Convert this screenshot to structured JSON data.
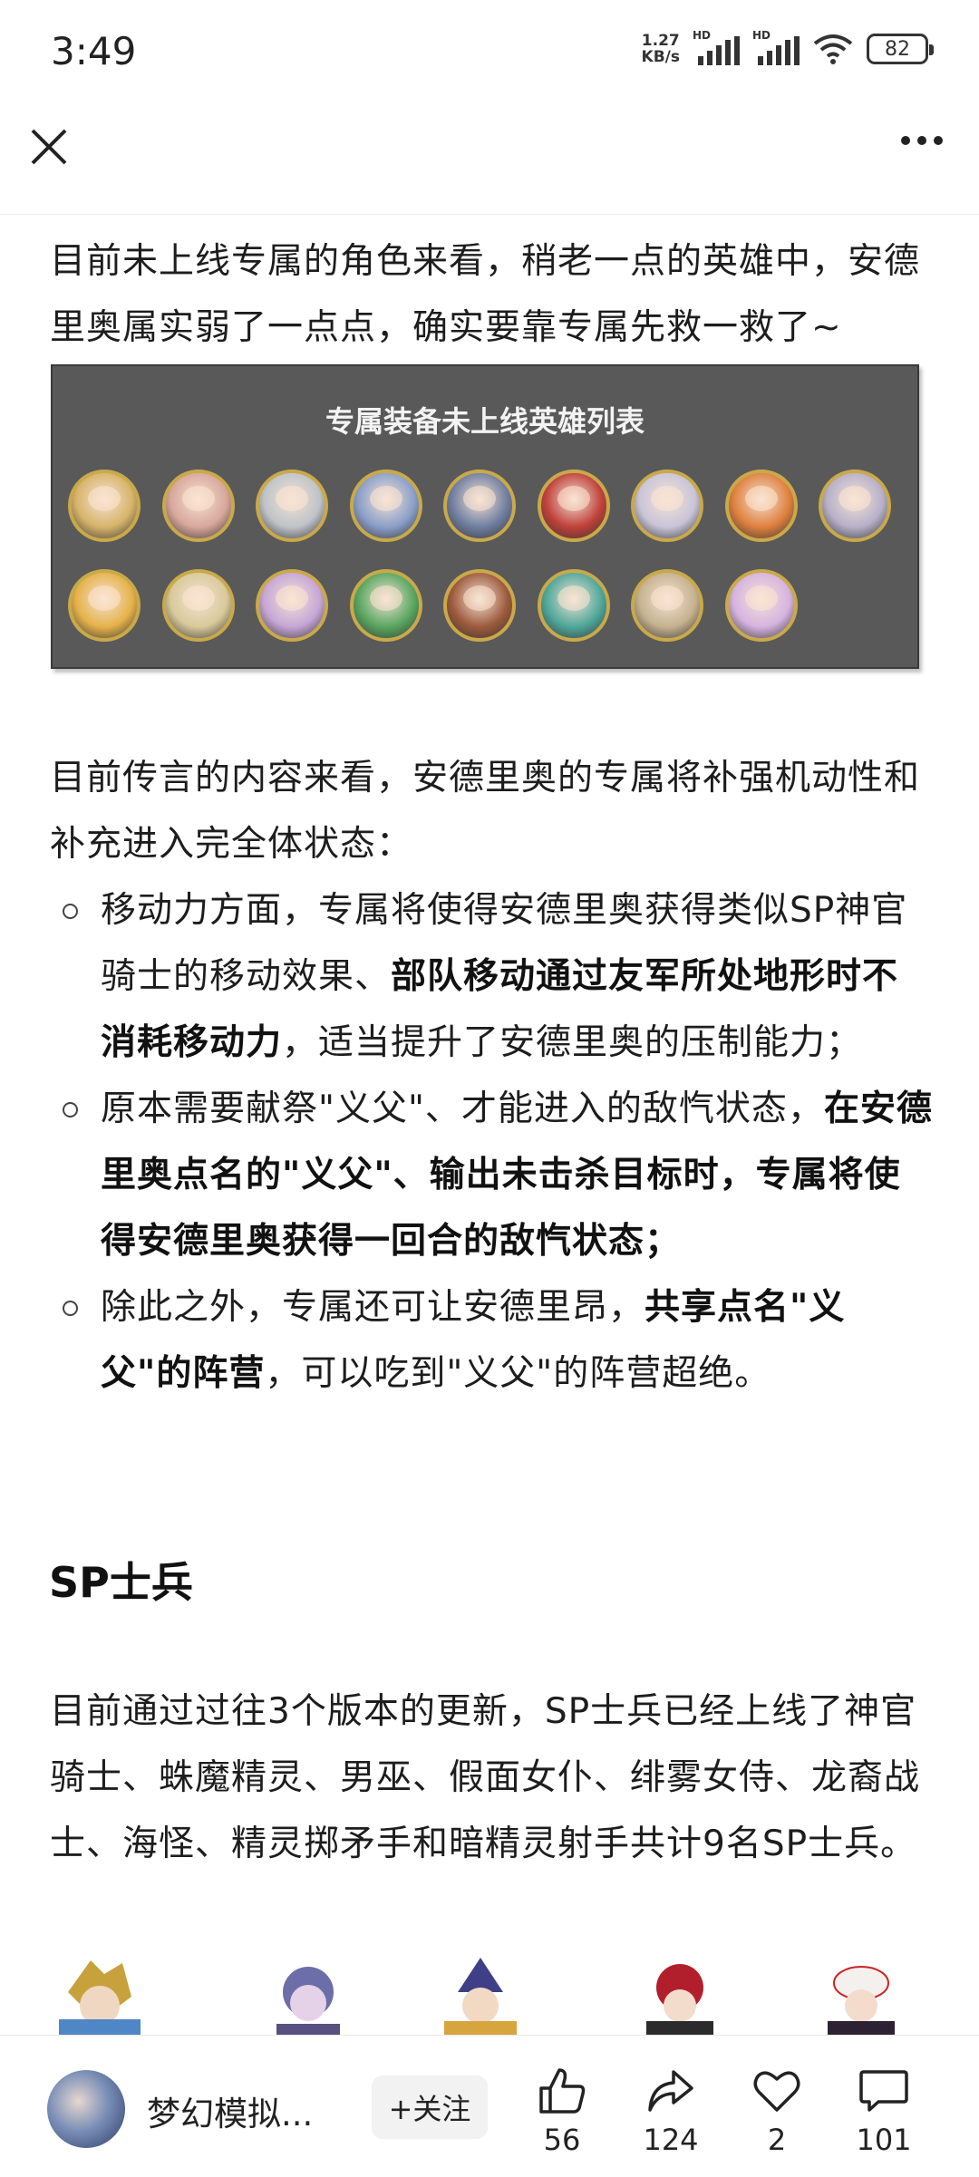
{
  "status_bar": {
    "time": "3:49",
    "net_speed_value": "1.27",
    "net_speed_unit": "KB/s",
    "battery": "82"
  },
  "article": {
    "para1": "目前未上线专属的角色来看，稍老一点的英雄中，安德里奥属实弱了一点点，确实要靠专属先救一救了~",
    "image_title": "专属装备未上线英雄列表",
    "para2": "目前传言的内容来看，安德里奥的专属将补强机动性和补充进入完全体状态：",
    "bullets": [
      {
        "pre": "移动力方面，专属将使得安德里奥获得类似SP神官骑士的移动效果、",
        "bold": "部队移动通过友军所处地形时不消耗移动力",
        "post": "，适当提升了安德里奥的压制能力；"
      },
      {
        "pre": "原本需要献祭\"义父\"、才能进入的敌忾状态，",
        "bold": "在安德里奥点名的\"义父\"、输出未击杀目标时，专属将使得安德里奥获得一回合的敌忾状态；",
        "post": ""
      },
      {
        "pre": "除此之外，专属还可让安德里昂，",
        "bold": "共享点名\"义父\"的阵营",
        "post": "，可以吃到\"义父\"的阵营超绝。"
      }
    ],
    "heading": "SP士兵",
    "para3": "目前通过过往3个版本的更新，SP士兵已经上线了神官骑士、蛛魔精灵、男巫、假面女仆、绯雾女侍、龙裔战士、海怪、精灵掷矛手和暗精灵射手共计9名SP士兵。"
  },
  "bottom_bar": {
    "author": "梦幻模拟...",
    "follow_label": "+关注",
    "likes": "56",
    "shares": "124",
    "favorites": "2",
    "comments": "101"
  },
  "colors": {
    "image_bg": "#595959",
    "hero_ring": "#c9a94a"
  }
}
